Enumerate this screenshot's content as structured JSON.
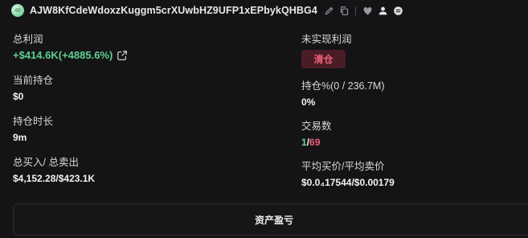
{
  "header": {
    "address": "AJW8KfCdeWdoxzKuggm5crXUwbHZ9UFP1xEPbykQHBG4",
    "icons": [
      "avatar",
      "edit-icon",
      "copy-icon",
      "heart-icon",
      "user-icon",
      "globe-icon"
    ]
  },
  "stats": {
    "total_pnl": {
      "label": "总利润",
      "value": "+$414.6K(+4885.6%)"
    },
    "unrealized_pnl": {
      "label": "未实现利润",
      "button": "清仓"
    },
    "current_holding": {
      "label": "当前持仓",
      "value": "$0"
    },
    "holding_pct": {
      "label": "持仓%(0 / 236.7M)",
      "value": "0%"
    },
    "holding_duration": {
      "label": "持仓时长",
      "value": "9m"
    },
    "trades": {
      "label": "交易数",
      "buys": "1",
      "slash": "/",
      "sells": "69"
    },
    "total_buy_sell": {
      "label": "总买入/ 总卖出",
      "value": "$4,152.28/$423.1K"
    },
    "avg_price": {
      "label": "平均买价/平均卖价",
      "value": "$0.0₄17544/$0.00179"
    }
  },
  "panel": {
    "title": "资产盈亏"
  },
  "colors": {
    "green": "#5fd08e",
    "red": "#f0607a",
    "background": "#141416"
  }
}
